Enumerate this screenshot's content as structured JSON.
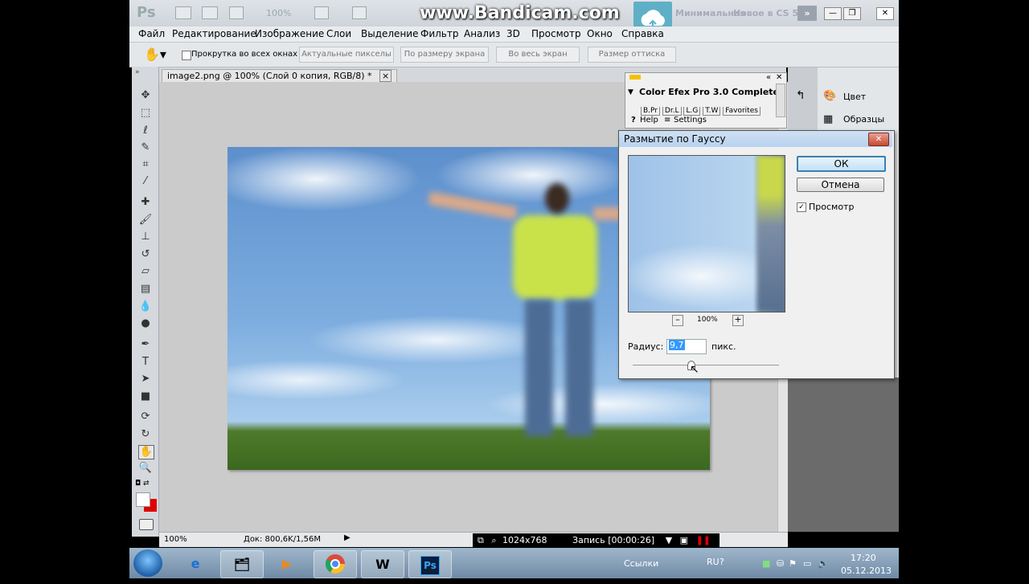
{
  "app": {
    "logo": "Ps",
    "zoom_label": "100%",
    "watermark": "www.Bandicam.com",
    "workspaces": [
      "Минимальная",
      "Новое в CS 5"
    ]
  },
  "menu": [
    "Файл",
    "Редактирование",
    "Изображение",
    "Слои",
    "Выделение",
    "Фильтр",
    "Анализ",
    "3D",
    "Просмотр",
    "Окно",
    "Справка"
  ],
  "options": {
    "scroll_all_label": "Прокрутка во всех окнах",
    "scroll_all_checked": false,
    "buttons": [
      "Актуальные пикселы",
      "По размеру экрана",
      "Во весь экран",
      "Размер оттиска"
    ]
  },
  "document": {
    "tab_title": "image2.png @ 100% (Слой 0 копия, RGB/8) *",
    "tab_close": "×"
  },
  "status": {
    "zoom": "100%",
    "doc_size": "Док: 800,6K/1,56M"
  },
  "recorder": {
    "resolution": "1024x768",
    "recording": "Запись [00:00:26]"
  },
  "panels": {
    "items": [
      {
        "icon": "palette-icon",
        "label": "Цвет"
      },
      {
        "icon": "swatches-icon",
        "label": "Образцы"
      }
    ]
  },
  "efex": {
    "title": "Color Efex Pro 3.0 Complete",
    "tabs": [
      "B.Pr",
      "Dr.L",
      "L.G",
      "T.W",
      "Favorites"
    ],
    "help": "Help",
    "settings": "Settings"
  },
  "dialog": {
    "title": "Размытие по Гауссу",
    "ok": "ОК",
    "cancel": "Отмена",
    "preview_label": "Просмотр",
    "preview_checked": true,
    "zoom_out": "–",
    "zoom_in": "+",
    "preview_zoom": "100%",
    "radius_label": "Радиус:",
    "radius_value": "9,7",
    "radius_unit": "пикс."
  },
  "taskbar": {
    "links_label": "Ссылки",
    "language": "RU",
    "time": "17:20",
    "date": "05.12.2013",
    "apps": [
      "ie-icon",
      "explorer-icon",
      "media-player-icon",
      "chrome-icon",
      "world-of-tanks-icon",
      "photoshop-icon"
    ]
  },
  "colors": {
    "accent": "#3399ff",
    "foreground_swatch": "#ffffff",
    "background_swatch": "#e00000",
    "record_red": "#e00000"
  }
}
